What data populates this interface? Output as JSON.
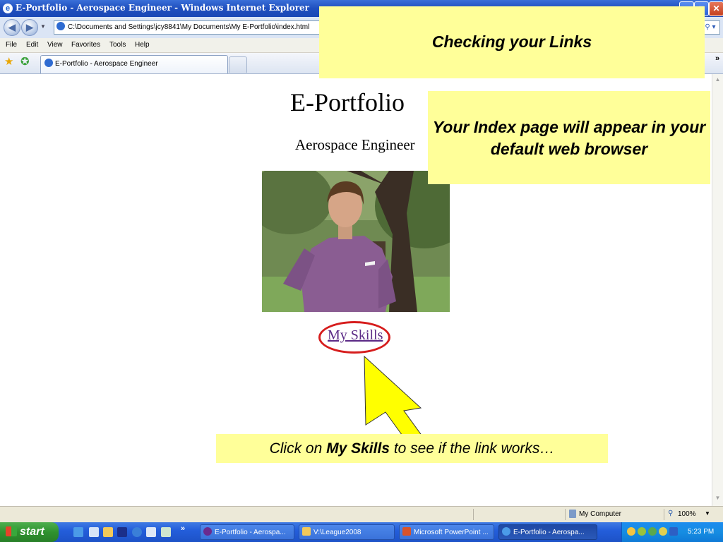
{
  "window": {
    "title": "E-Portfolio - Aerospace Engineer - Windows Internet Explorer",
    "controls": {
      "minimize": "_",
      "maximize": "□",
      "close": "✕"
    }
  },
  "navigation": {
    "back_icon": "back-arrow-icon",
    "forward_icon": "forward-arrow-icon",
    "address": "C:\\Documents and Settings\\jcy8841\\My Documents\\My E-Portfolio\\index.html"
  },
  "menu": {
    "items": [
      "File",
      "Edit",
      "View",
      "Favorites",
      "Tools",
      "Help"
    ]
  },
  "tabs": {
    "active_label": "E-Portfolio - Aerospace Engineer"
  },
  "page": {
    "title": "E-Portfolio",
    "subtitle": "Aerospace Engineer",
    "link_text": "My Skills"
  },
  "callouts": {
    "title": "Checking your Links",
    "index_note": "Your Index page will appear in your default web browser",
    "click_pre": "Click on ",
    "click_bold": "My Skills",
    "click_post": " to see if the link works…"
  },
  "statusbar": {
    "zone": "My Computer",
    "zoom": "100%"
  },
  "taskbar": {
    "start": "start",
    "tasks": [
      "E-Portfolio - Aerospa...",
      "V:\\League2008",
      "Microsoft PowerPoint ...",
      "E-Portfolio - Aerospa..."
    ],
    "clock": "5:23 PM"
  },
  "colors": {
    "callout": "#ffff99",
    "link": "#5b2a86",
    "highlight_ring": "#d61d1d",
    "arrow": "#ffff00"
  }
}
